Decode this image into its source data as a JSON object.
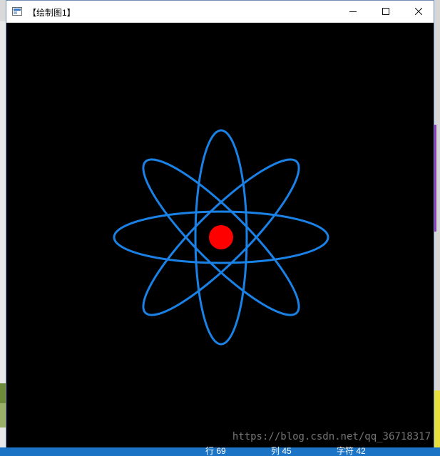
{
  "window": {
    "title": "【绘制图1】",
    "controls": {
      "minimize_icon": "minimize-icon",
      "maximize_icon": "maximize-icon",
      "close_icon": "close-icon"
    }
  },
  "drawing": {
    "background_color": "#000000",
    "orbit_color": "#1a82e6",
    "nucleus_color": "#ff0000",
    "orbits": [
      {
        "name": "horizontal-orbit",
        "rotation_deg": 0
      },
      {
        "name": "vertical-orbit",
        "rotation_deg": 90
      },
      {
        "name": "diagonal-orbit-right",
        "rotation_deg": 45
      },
      {
        "name": "diagonal-orbit-left",
        "rotation_deg": -45
      }
    ]
  },
  "watermark": "https://blog.csdn.net/qq_36718317",
  "status_bar": {
    "line": "行 69",
    "column": "列 45",
    "char": "字符 42"
  }
}
